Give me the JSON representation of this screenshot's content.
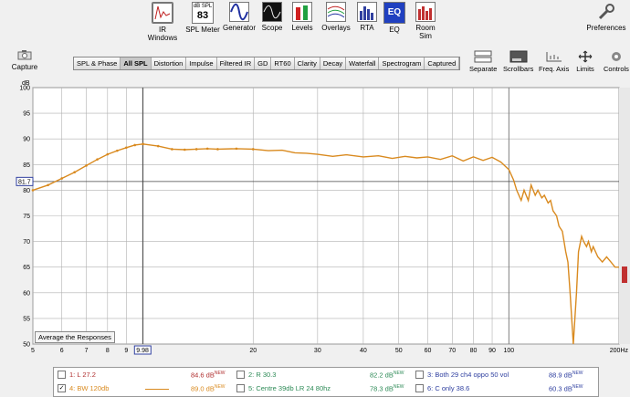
{
  "toolbar": {
    "items": [
      {
        "label": "IR Windows"
      },
      {
        "label": "SPL Meter",
        "readout_top": "dB SPL",
        "readout_value": "83"
      },
      {
        "label": "Generator"
      },
      {
        "label": "Scope"
      },
      {
        "label": "Levels"
      },
      {
        "label": "Overlays"
      },
      {
        "label": "RTA"
      },
      {
        "label": "EQ",
        "icon_text": "EQ"
      },
      {
        "label": "Room Sim"
      }
    ],
    "preferences": "Preferences"
  },
  "capture": {
    "label": "Capture"
  },
  "tabs": [
    "SPL & Phase",
    "All SPL",
    "Distortion",
    "Impulse",
    "Filtered IR",
    "GD",
    "RT60",
    "Clarity",
    "Decay",
    "Waterfall",
    "Spectrogram",
    "Captured"
  ],
  "active_tab": "All SPL",
  "right_buttons": [
    "Separate",
    "Scrollbars",
    "Freq. Axis",
    "Limits",
    "Controls"
  ],
  "graph": {
    "y_unit": "dB",
    "cursor_y": "81.7",
    "cursor_x": "9.98",
    "average_button": "Average the Responses",
    "colors": {
      "curve": "#d98a1f",
      "grid": "#b0b0b0",
      "bg": "#ffffff"
    }
  },
  "chart_data": {
    "type": "line",
    "x_scale": "log",
    "xlim": [
      5,
      200
    ],
    "ylim": [
      50,
      100
    ],
    "ylabel": "dB",
    "x_ticks": [
      "5",
      "6",
      "7",
      "8",
      "9",
      "9.98",
      "20",
      "30",
      "40",
      "50",
      "60",
      "70",
      "80",
      "90",
      "100",
      "200Hz"
    ],
    "y_ticks": [
      "50",
      "55",
      "60",
      "65",
      "70",
      "75",
      "80",
      "85",
      "90",
      "95",
      "100"
    ],
    "series": [
      {
        "name": "BW 120db",
        "x": [
          5,
          5.5,
          6,
          6.5,
          7,
          7.5,
          8,
          8.5,
          9,
          9.5,
          10,
          11,
          12,
          13,
          14,
          15,
          16,
          18,
          20,
          22,
          24,
          26,
          28,
          30,
          33,
          36,
          40,
          44,
          48,
          52,
          56,
          60,
          65,
          70,
          75,
          80,
          85,
          90,
          95,
          100,
          103,
          105,
          108,
          110,
          113,
          115,
          118,
          120,
          123,
          125,
          128,
          130,
          132,
          135,
          137,
          140,
          143,
          145,
          147,
          150,
          153,
          155,
          158,
          160,
          163,
          165,
          168,
          170,
          175,
          180,
          185,
          190,
          195,
          200
        ],
        "y": [
          80,
          81,
          82.3,
          83.5,
          84.8,
          86,
          87,
          87.7,
          88.3,
          88.8,
          89,
          88.6,
          88,
          87.9,
          88,
          88.1,
          88,
          88.1,
          88,
          87.7,
          87.8,
          87.3,
          87.2,
          87,
          86.6,
          86.9,
          86.5,
          86.7,
          86.2,
          86.6,
          86.3,
          86.5,
          86,
          86.7,
          85.7,
          86.5,
          85.8,
          86.4,
          85.5,
          84,
          82,
          80,
          78,
          80,
          78,
          81,
          79,
          80,
          78.5,
          79,
          77.5,
          78,
          76,
          75,
          73,
          72,
          68,
          66,
          60,
          50,
          60,
          68,
          71,
          70,
          69,
          70,
          68,
          69,
          67,
          66,
          67,
          66,
          65,
          65
        ]
      }
    ]
  },
  "legend": {
    "rows": [
      [
        {
          "checked": false,
          "name": "1: L 27.2",
          "value": "84.6 dB",
          "sup": "NEW",
          "color": "#b03030"
        },
        {
          "checked": false,
          "name": "2: R 30.3",
          "value": "82.2 dB",
          "sup": "NEW",
          "color": "#2e8b57"
        },
        {
          "checked": false,
          "name": "3: Both 29 ch4 oppo 50 vol",
          "value": "88.9 dB",
          "sup": "NEW",
          "color": "#3040a0"
        }
      ],
      [
        {
          "checked": true,
          "name": "4: BW 120db",
          "value": "89.0 dB",
          "sup": "NEW",
          "color": "#d98a1f"
        },
        {
          "checked": false,
          "name": "5: Centre 39db LR 24 80hz",
          "value": "78.3 dB",
          "sup": "NEW",
          "color": "#2e8b57"
        },
        {
          "checked": false,
          "name": "6: C only 38.6",
          "value": "60.3 dB",
          "sup": "NEW",
          "color": "#3040a0"
        }
      ]
    ]
  }
}
